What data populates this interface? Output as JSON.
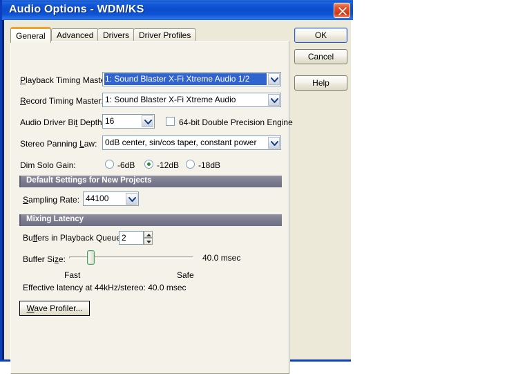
{
  "window": {
    "title": "Audio Options - WDM/KS",
    "close_icon": "close-x-icon"
  },
  "tabs": [
    {
      "label": "General",
      "active": true
    },
    {
      "label": "Advanced",
      "active": false
    },
    {
      "label": "Drivers",
      "active": false
    },
    {
      "label": "Driver Profiles",
      "active": false
    }
  ],
  "buttons": {
    "ok": "OK",
    "cancel": "Cancel",
    "help": "Help",
    "wave_profiler": "Wave Profiler..."
  },
  "general": {
    "playback_timing_master": {
      "label_pre": "",
      "label_mn": "P",
      "label_post": "layback Timing Master:",
      "value": "1: Sound Blaster X-Fi Xtreme Audio 1/2",
      "selected": true
    },
    "record_timing_master": {
      "label_mn": "R",
      "label_post": "ecord Timing Master:",
      "value": "1: Sound Blaster X-Fi Xtreme Audio",
      "selected": false
    },
    "audio_driver_bit_depth": {
      "label_pre": "Audio Driver Bi",
      "label_mn": "t",
      "label_post": " Depth:",
      "value": "16"
    },
    "double_precision": {
      "label": "64-bit Double Precision Engine",
      "checked": false
    },
    "stereo_panning_law": {
      "label_pre": "Stereo Panning ",
      "label_mn": "L",
      "label_post": "aw:",
      "value": "0dB center, sin/cos taper, constant power"
    },
    "dim_solo_gain": {
      "label": "Dim Solo Gain:",
      "options": [
        {
          "label": "-6dB",
          "selected": false
        },
        {
          "label": "-12dB",
          "selected": true
        },
        {
          "label": "-18dB",
          "selected": false
        }
      ]
    }
  },
  "default_settings_group": {
    "header": "Default Settings for New Projects",
    "sampling_rate": {
      "label_mn": "S",
      "label_post": "ampling Rate:",
      "value": "44100"
    }
  },
  "mixing_latency_group": {
    "header": "Mixing Latency",
    "buffers_in_playback_queue": {
      "label_pre": "Bu",
      "label_mn": "ff",
      "label_post": "ers in Playback Queue:",
      "value": "2"
    },
    "buffer_size": {
      "label_pre": "Buffer Si",
      "label_mn": "z",
      "label_post": "e:",
      "value_text": "40.0 msec",
      "min_label": "Fast",
      "max_label": "Safe",
      "position_percent": 19
    },
    "effective_latency": "Effective latency at 44kHz/stereo:  40.0 msec"
  }
}
